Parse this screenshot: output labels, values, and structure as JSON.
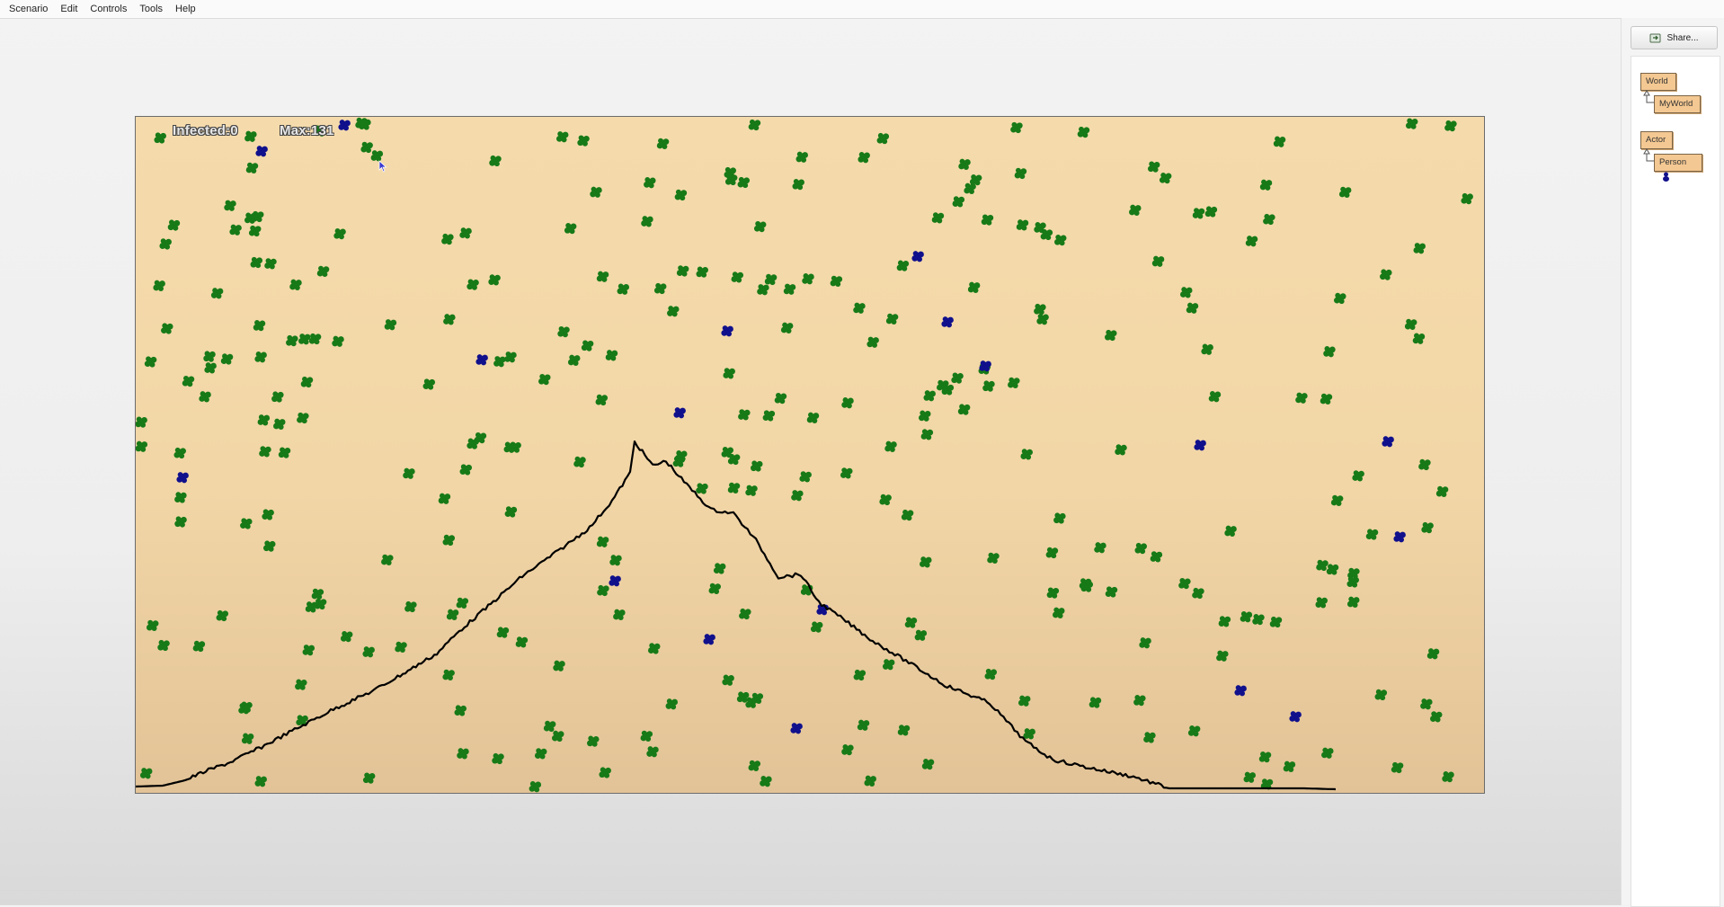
{
  "menu": [
    "Scenario",
    "Edit",
    "Controls",
    "Tools",
    "Help"
  ],
  "hud": {
    "infected_text": "Infected:0",
    "max_text": "Max:131"
  },
  "colors": {
    "healthy": "#177a17",
    "infected": "#10108c",
    "curve": "#000000",
    "class_node": "#f4c892"
  },
  "toolbar": {
    "share_label": "Share..."
  },
  "class_tree": {
    "world": "World",
    "myworld": "MyWorld",
    "actor": "Actor",
    "person": "Person"
  },
  "icons": {
    "share": "share-icon",
    "person_class": "person-class-icon",
    "cursor": "cursor-icon"
  }
}
